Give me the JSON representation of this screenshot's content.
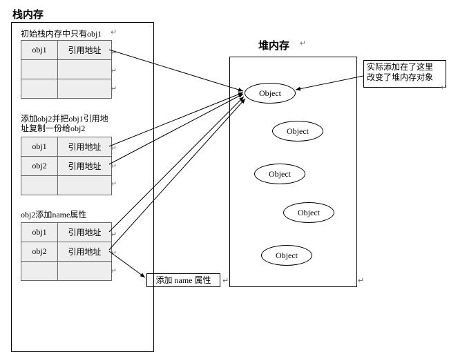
{
  "stack": {
    "title": "栈内存",
    "group1": {
      "title": "初始栈内存中只有obj1",
      "rows": [
        {
          "name": "obj1",
          "value": "引用地址"
        }
      ]
    },
    "group2": {
      "title_l1": "添加obj2并把obj1引用地",
      "title_l2": "址复制一份给obj2",
      "rows": [
        {
          "name": "obj1",
          "value": "引用地址"
        },
        {
          "name": "obj2",
          "value": "引用地址"
        }
      ]
    },
    "group3": {
      "title": "obj2添加name属性",
      "rows": [
        {
          "name": "obj1",
          "value": "引用地址"
        },
        {
          "name": "obj2",
          "value": "引用地址"
        }
      ]
    }
  },
  "heap": {
    "title": "堆内存",
    "objects": [
      "Object",
      "Object",
      "Object",
      "Object",
      "Object"
    ]
  },
  "callout1": {
    "l1": "实际添加在了这里",
    "l2": "改变了堆内存对象"
  },
  "callout2": "添加 name 属性",
  "crlf": "↵"
}
